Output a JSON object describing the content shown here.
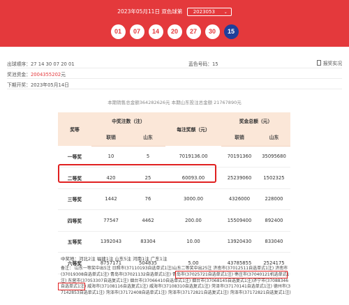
{
  "header": {
    "date_line": "2023年05月11日 双色球第",
    "issue_value": "2023053",
    "issue_chevron_icon": "chevron-down-icon",
    "red_balls": [
      "01",
      "07",
      "14",
      "20",
      "27",
      "30"
    ],
    "blue_ball": "15",
    "colors": {
      "header_red": "#e4393c",
      "blue_ball": "#1f3f9b"
    }
  },
  "info": {
    "order_label": "出球顺序：",
    "order_value": "27  14  30  07  20  01",
    "blue_label": "蓝色号码：",
    "blue_value": "15",
    "report_icon": "document-icon",
    "report_label": "报奖实况",
    "pool_label": "奖池资金：",
    "pool_value": "2004355202",
    "pool_unit": "元",
    "deadline_label": "下期开奖：",
    "deadline_value": "2023年05月14日"
  },
  "summary": "本期销售总金额364282626元 本期山东投注总金额 21767890元",
  "table": {
    "col_level": "奖等",
    "group_count": "中奖注数（注）",
    "col_bonus": "每注奖额（元）",
    "group_total": "奖金总额（元）",
    "sub_national": "联销",
    "sub_shandong": "山东",
    "sub_national2": "联销",
    "sub_shandong2": "山东",
    "rows": [
      {
        "level": "一等奖",
        "national": "10",
        "shandong": "5",
        "bonus": "7019136.00",
        "total_national": "70191360",
        "total_shandong": "35095680"
      },
      {
        "level": "二等奖",
        "national": "420",
        "shandong": "25",
        "bonus": "60093.00",
        "total_national": "25239060",
        "total_shandong": "1502325"
      },
      {
        "level": "三等奖",
        "national": "1442",
        "shandong": "76",
        "bonus": "3000.00",
        "total_national": "4326000",
        "total_shandong": "228000"
      },
      {
        "level": "四等奖",
        "national": "77547",
        "shandong": "4462",
        "bonus": "200.00",
        "total_national": "15509400",
        "total_shandong": "892400"
      },
      {
        "level": "五等奖",
        "national": "1392043",
        "shandong": "83304",
        "bonus": "10.00",
        "total_national": "13920430",
        "total_shandong": "833040"
      },
      {
        "level": "六等奖",
        "national": "8757171",
        "shandong": "504835",
        "bonus": "5.00",
        "total_national": "43785855",
        "total_shandong": "2524175"
      }
    ]
  },
  "areas": "中奖地：河北2注 福建1注 山东5注 河南1注 广东1注",
  "note": "备注： 山东一等奖中出5注 日照市(37110193自选单式1注)山东二等奖中出25注 济南市(37012511自选单式1注) 济南市(37019308自选单式1注) 青岛市(37021132自选单式1注) 青岛市(37025721自选单式1注) 枣庄市(37040121机选单式1注) 东营市(37053307自选复式1注) 烟台市(37066410自选单式1注) 烟台市(37068145自选复式1注)济宁市(37088346自选单式1注) 威海市(37108116自选复式1注) 威海市(37108310自选复式1注) 菏泽市(37170141自选单式1注) 德州市(37142853自选单式1注) 菏泽市(37172408自选单式1注) 菏泽市(37172821自选复式1注) 菏泽市(37172821自选复式1注)"
}
